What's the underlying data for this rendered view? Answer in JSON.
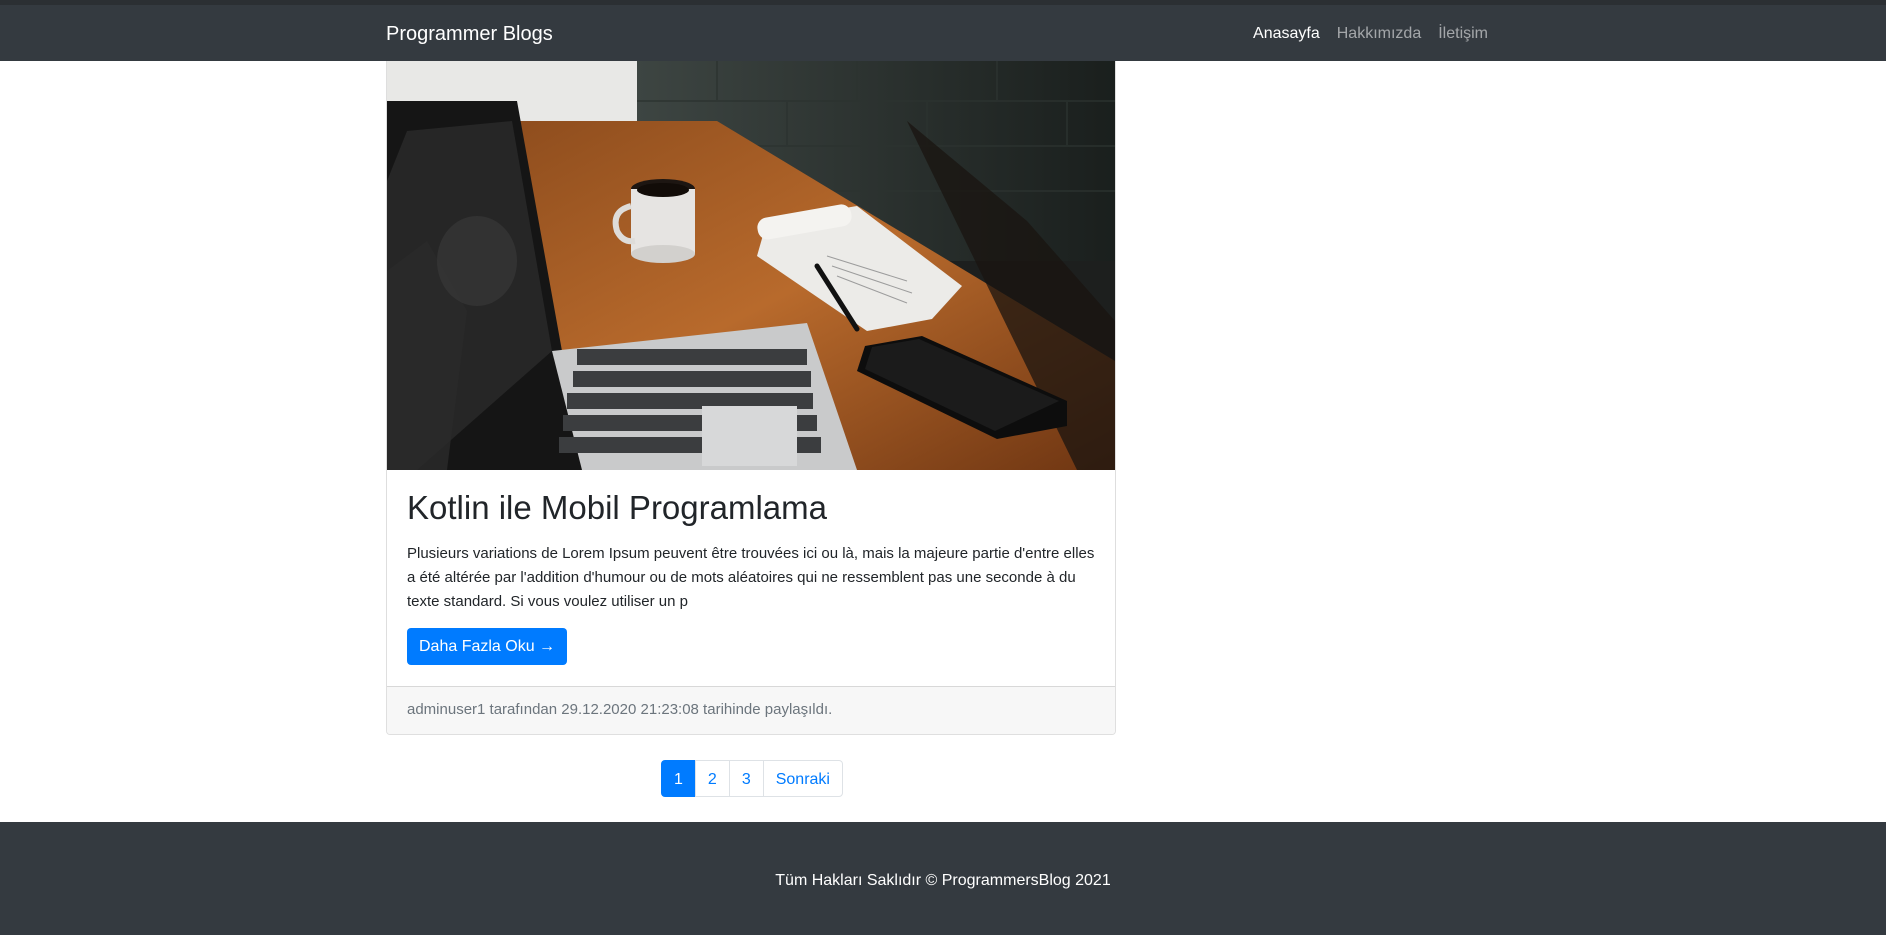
{
  "navbar": {
    "brand": "Programmer Blogs",
    "links": [
      {
        "label": "Anasayfa",
        "active": true
      },
      {
        "label": "Hakkımızda",
        "active": false
      },
      {
        "label": "İletişim",
        "active": false
      }
    ]
  },
  "post": {
    "image": "laptop-coffee-desk-photo",
    "title": "Kotlin ile Mobil Programlama",
    "excerpt": "Plusieurs variations de Lorem Ipsum peuvent être trouvées ici ou là, mais la majeure partie d'entre elles a été altérée par l'addition d'humour ou de mots aléatoires qui ne ressemblent pas une seconde à du texte standard. Si vous voulez utiliser un p",
    "read_more_label": "Daha Fazla Oku →",
    "footer_text": "adminuser1 tarafından 29.12.2020 21:23:08 tarihinde paylaşıldı."
  },
  "pagination": {
    "pages": [
      "1",
      "2",
      "3"
    ],
    "current": "1",
    "next_label": "Sonraki"
  },
  "footer": {
    "text": "Tüm Hakları Saklıdır © ProgrammersBlog 2021"
  },
  "colors": {
    "navbar_bg": "#343a40",
    "primary": "#007bff",
    "card_footer_bg": "#f7f7f7"
  }
}
